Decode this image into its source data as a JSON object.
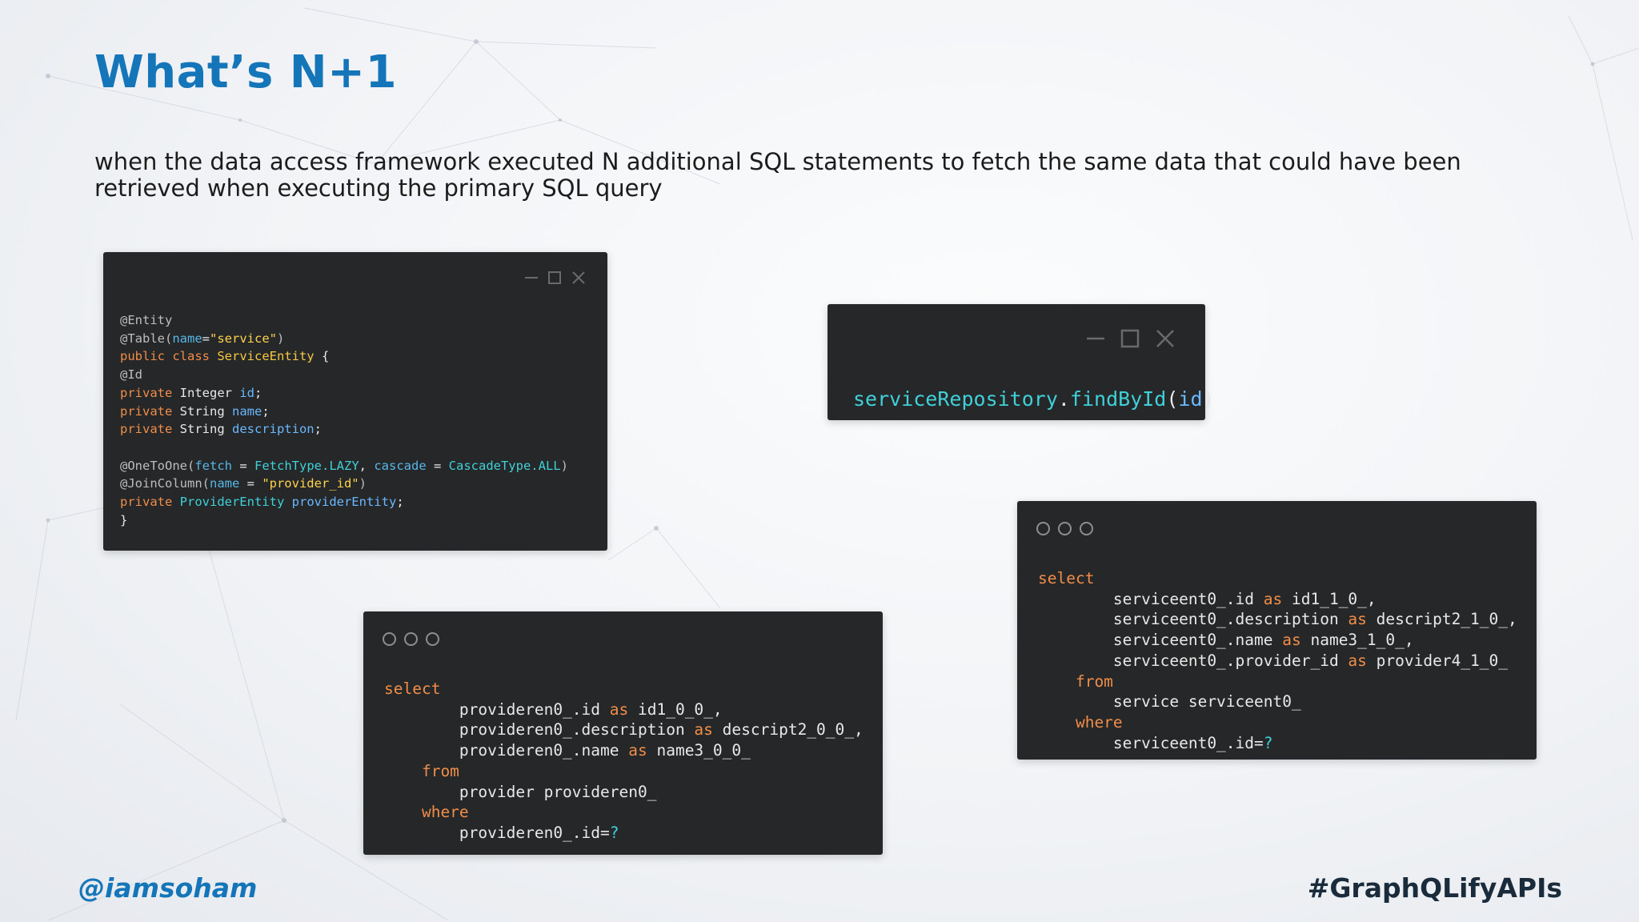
{
  "slide": {
    "title": "What’s N+1",
    "description": "when the data access framework executed N additional SQL statements to fetch the same data that could have been retrieved when executing the primary SQL query"
  },
  "code_windows": {
    "entity": {
      "lines": [
        "@Entity",
        "@Table(name=\"service\")",
        "public class ServiceEntity {",
        "@Id",
        "private Integer id;",
        "private String name;",
        "private String description;",
        "",
        "@OneToOne(fetch = FetchType.LAZY, cascade = CascadeType.ALL)",
        "@JoinColumn(name = \"provider_id\")",
        "private ProviderEntity providerEntity;",
        "}"
      ]
    },
    "find_by_id": {
      "code": "serviceRepository.findById(id)"
    },
    "provider_sql": {
      "lines": [
        "select",
        "        provideren0_.id as id1_0_0_,",
        "        provideren0_.description as descript2_0_0_,",
        "        provideren0_.name as name3_0_0_",
        "    from",
        "        provider provideren0_",
        "    where",
        "        provideren0_.id=?"
      ]
    },
    "service_sql": {
      "lines": [
        "select",
        "        serviceent0_.id as id1_1_0_,",
        "        serviceent0_.description as descript2_1_0_,",
        "        serviceent0_.name as name3_1_0_,",
        "        serviceent0_.provider_id as provider4_1_0_",
        "    from",
        "        service serviceent0_",
        "    where",
        "        serviceent0_.id=?"
      ]
    }
  },
  "footer": {
    "handle": "@iamsoham",
    "hashtag": "#GraphQLifyAPIs"
  },
  "colors": {
    "title": "#1476b8",
    "code_background": "#262729",
    "keyword": "#f08d49",
    "string": "#ffd24d",
    "identifier": "#3fd0d8"
  },
  "icons": [
    "minimize-icon",
    "maximize-icon",
    "close-icon",
    "traffic-dot-icon"
  ]
}
